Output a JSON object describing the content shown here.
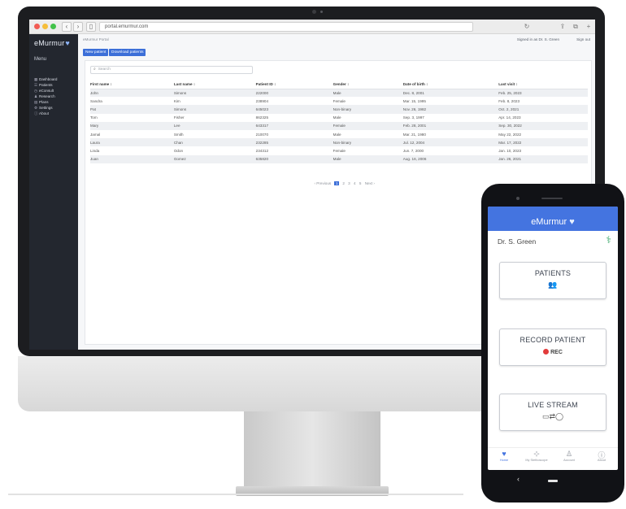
{
  "browser": {
    "url": "portal.emurmur.com",
    "back": "‹",
    "forward": "›"
  },
  "sidebar": {
    "logo": "eMurmur",
    "menu_title": "Menu",
    "items": [
      {
        "icon": "▦",
        "label": "Dashboard"
      },
      {
        "icon": "☰",
        "label": "Patients"
      },
      {
        "icon": "◷",
        "label": "eConsult"
      },
      {
        "icon": "♟",
        "label": "Research"
      },
      {
        "icon": "▤",
        "label": "Plans"
      },
      {
        "icon": "⚙",
        "label": "Settings"
      },
      {
        "icon": "ⓘ",
        "label": "About"
      }
    ]
  },
  "header": {
    "breadcrumb": "eMurmur Portal",
    "signed_in": "Signed in as Dr. S. Green",
    "sign_out": "Sign out"
  },
  "actions": {
    "new_patient": "New patient",
    "download": "Download patients"
  },
  "search": {
    "placeholder": "Search"
  },
  "table": {
    "headers": [
      "First name ↕",
      "Last name ↕",
      "Patient ID ↕",
      "Gender ↕",
      "Date of birth ↕",
      "Last visit ↕"
    ],
    "rows": [
      [
        "John",
        "Simons",
        "222000",
        "Male",
        "Dec. 8, 2001",
        "Feb. 25, 2023"
      ],
      [
        "Sandra",
        "Kim",
        "238904",
        "Female",
        "Mar. 15, 1995",
        "Feb. 8, 2023"
      ],
      [
        "Pat",
        "Simons",
        "645023",
        "Non-binary",
        "Nov. 26, 1982",
        "Oct. 2, 2021"
      ],
      [
        "Tom",
        "Fisher",
        "862325",
        "Male",
        "Sep. 3, 1997",
        "Apr. 14, 2023"
      ],
      [
        "Mary",
        "Lee",
        "643317",
        "Female",
        "Feb. 28, 2001",
        "Sep. 30, 2022"
      ],
      [
        "Jamal",
        "Smith",
        "210070",
        "Male",
        "Mar. 21, 1980",
        "May 22, 2022"
      ],
      [
        "Laura",
        "Chan",
        "232285",
        "Non-binary",
        "Jul. 12, 2004",
        "Mar. 17, 2022"
      ],
      [
        "Linda",
        "Odon",
        "234312",
        "Female",
        "Jun. 7, 2000",
        "Jan. 10, 2023"
      ],
      [
        "Juan",
        "Gomez",
        "635820",
        "Male",
        "Aug. 16, 2006",
        "Jan. 26, 2021"
      ]
    ]
  },
  "pagination": {
    "prev": "‹ Previous",
    "pages": [
      "1",
      "2",
      "3",
      "4",
      "5"
    ],
    "next": "Next ›"
  },
  "phone": {
    "title": "eMurmur",
    "doctor": "Dr. S. Green",
    "patients_label": "PATIENTS",
    "record_label": "RECORD PATIENT",
    "rec_badge": "REC",
    "live_label": "LIVE STREAM",
    "tabs": [
      {
        "icon": "♥",
        "label": "Home"
      },
      {
        "icon": "⊹",
        "label": "My Stethoscope"
      },
      {
        "icon": "♙",
        "label": "Account"
      },
      {
        "icon": "ⓘ",
        "label": "About"
      }
    ]
  },
  "colors": {
    "accent": "#3c6fd8",
    "sidebar": "#23272f",
    "phone_header": "#4474e0",
    "rec": "#e23b3b"
  }
}
